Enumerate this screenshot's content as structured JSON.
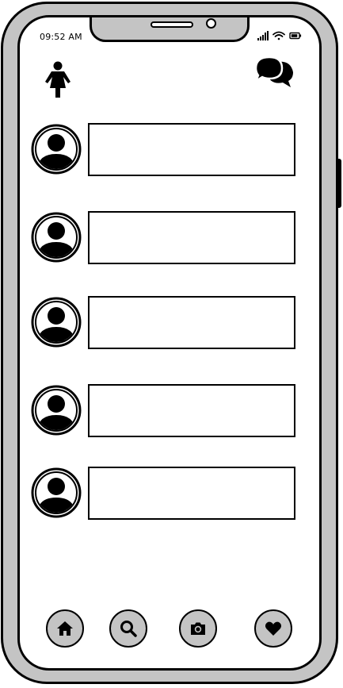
{
  "status_bar": {
    "time": "09:52 AM",
    "icons": [
      "signal-icon",
      "wifi-icon",
      "battery-icon"
    ]
  },
  "header": {
    "left_icon": "person-icon",
    "right_icon": "chat-bubbles-icon"
  },
  "list": {
    "items": [
      {
        "avatar": "user-avatar-icon",
        "text": ""
      },
      {
        "avatar": "user-avatar-icon",
        "text": ""
      },
      {
        "avatar": "user-avatar-icon",
        "text": ""
      },
      {
        "avatar": "user-avatar-icon",
        "text": ""
      },
      {
        "avatar": "user-avatar-icon",
        "text": ""
      }
    ]
  },
  "bottom_nav": {
    "items": [
      {
        "icon": "home-icon"
      },
      {
        "icon": "search-icon"
      },
      {
        "icon": "camera-icon"
      },
      {
        "icon": "heart-icon"
      }
    ]
  },
  "colors": {
    "frame": "#c4c4c4",
    "outline": "#000000",
    "screen": "#ffffff"
  }
}
